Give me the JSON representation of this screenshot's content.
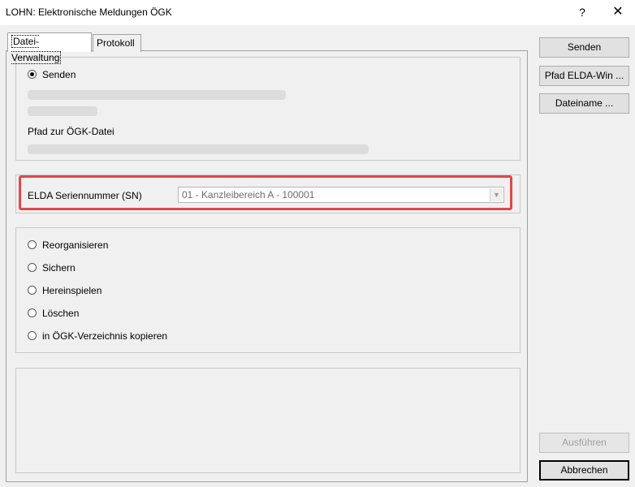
{
  "window": {
    "title": "LOHN: Elektronische Meldungen ÖGK",
    "help_icon": "?",
    "close_icon": "✕"
  },
  "tabs": [
    {
      "label": "Datei-Verwaltung",
      "active": true
    },
    {
      "label": "Protokoll",
      "active": false
    }
  ],
  "send_group": {
    "radio_label": "Senden",
    "path_label": "Pfad zur ÖGK-Datei"
  },
  "serial": {
    "label": "ELDA Seriennummer (SN)",
    "value": "01 - Kanzleibereich A - 100001",
    "arrow": "▼"
  },
  "options": [
    {
      "label": "Reorganisieren"
    },
    {
      "label": "Sichern"
    },
    {
      "label": "Hereinspielen"
    },
    {
      "label": "Löschen"
    },
    {
      "label": "in ÖGK-Verzeichnis kopieren"
    }
  ],
  "buttons": {
    "senden": "Senden",
    "pfad_elda": "Pfad ELDA-Win ...",
    "dateiname": "Dateiname ...",
    "ausfuehren": "Ausführen",
    "abbrechen": "Abbrechen"
  },
  "colors": {
    "highlight": "#e0474c",
    "background": "#f0f0f0"
  }
}
